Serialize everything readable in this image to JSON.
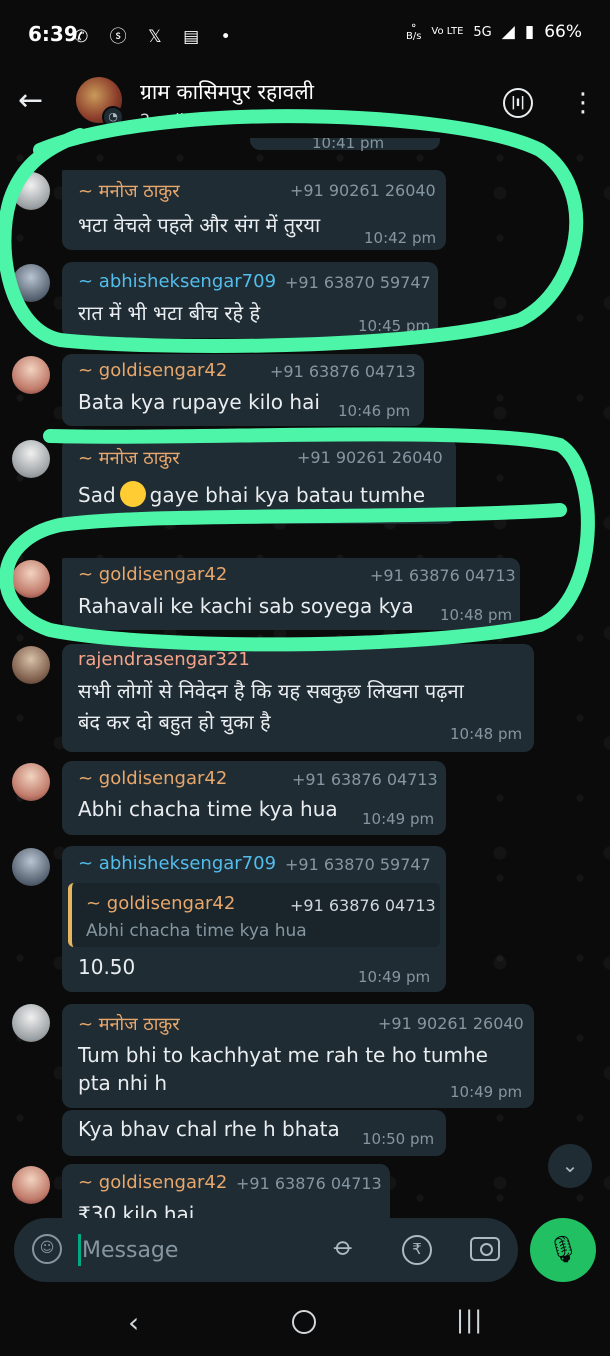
{
  "status_bar": {
    "time": "6:39",
    "battery": "66%",
    "network": "5G",
    "volte": "Vo LTE"
  },
  "header": {
    "title": "ग्राम कासिमपुर रहावली",
    "subtitle": "2 online"
  },
  "messages": [
    {
      "sender": "~ मनोज ठाकुर",
      "phone": "+91 90261 26040",
      "text": "भटा वेचले पहले और संग में तुरया",
      "time": "10:42 pm"
    },
    {
      "sender": "~ abhisheksengar709",
      "phone": "+91 63870 59747",
      "text": "रात में भी भटा बीच रहे हे",
      "time": "10:45 pm"
    },
    {
      "sender": "~ goldisengar42",
      "phone": "+91 63876 04713",
      "text": "Bata kya rupaye kilo hai",
      "time": "10:46 pm"
    },
    {
      "sender": "~ मनोज ठाकुर",
      "phone": "+91 90261 26040",
      "text_before": "Sad",
      "text_after": "gaye bhai kya batau tumhe",
      "emoji": "crying-face"
    },
    {
      "sender": "~ goldisengar42",
      "phone": "+91 63876 04713",
      "text": "Rahavali ke  kachi sab soyega kya",
      "time": "10:48 pm"
    },
    {
      "sender": "rajendrasengar321",
      "text_line1": "सभी लोगों से निवेदन है कि यह सबकुछ लिखना पढ़ना",
      "text_line2": "बंद कर दो बहुत हो चुका है",
      "time": "10:48 pm"
    },
    {
      "sender": "~ goldisengar42",
      "phone": "+91 63876 04713",
      "text": "Abhi chacha time kya hua",
      "time": "10:49 pm"
    },
    {
      "sender": "~ abhisheksengar709",
      "phone": "+91 63870 59747",
      "quote_sender": "~ goldisengar42",
      "quote_phone": "+91 63876 04713",
      "quote_text": "Abhi chacha time kya hua",
      "text": "10.50",
      "time": "10:49 pm"
    },
    {
      "sender": "~ मनोज ठाकुर",
      "phone": "+91 90261 26040",
      "text_line1": "Tum bhi to kachhyat me rah te ho tumhe",
      "text_line2": "pta nhi h",
      "time": "10:49 pm"
    },
    {
      "text": "Kya bhav chal rhe h bhata",
      "time": "10:50 pm"
    },
    {
      "sender": "~ goldisengar42",
      "phone": "+91 63876 04713",
      "text": "₹30 kilo hai"
    }
  ],
  "input": {
    "placeholder": "Message"
  },
  "colors": {
    "bubble": "#1f2c34",
    "accent_green": "#21c063",
    "annotation_ink": "#4df5a8"
  }
}
